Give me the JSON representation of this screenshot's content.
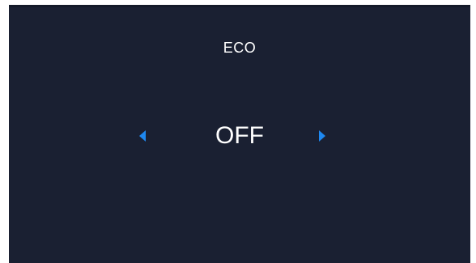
{
  "setting": {
    "title": "ECO",
    "value": "OFF"
  },
  "icons": {
    "left": "arrow-left-icon",
    "right": "arrow-right-icon"
  },
  "colors": {
    "background": "#1a2032",
    "text": "#ffffff",
    "accent": "#1e88f0"
  }
}
